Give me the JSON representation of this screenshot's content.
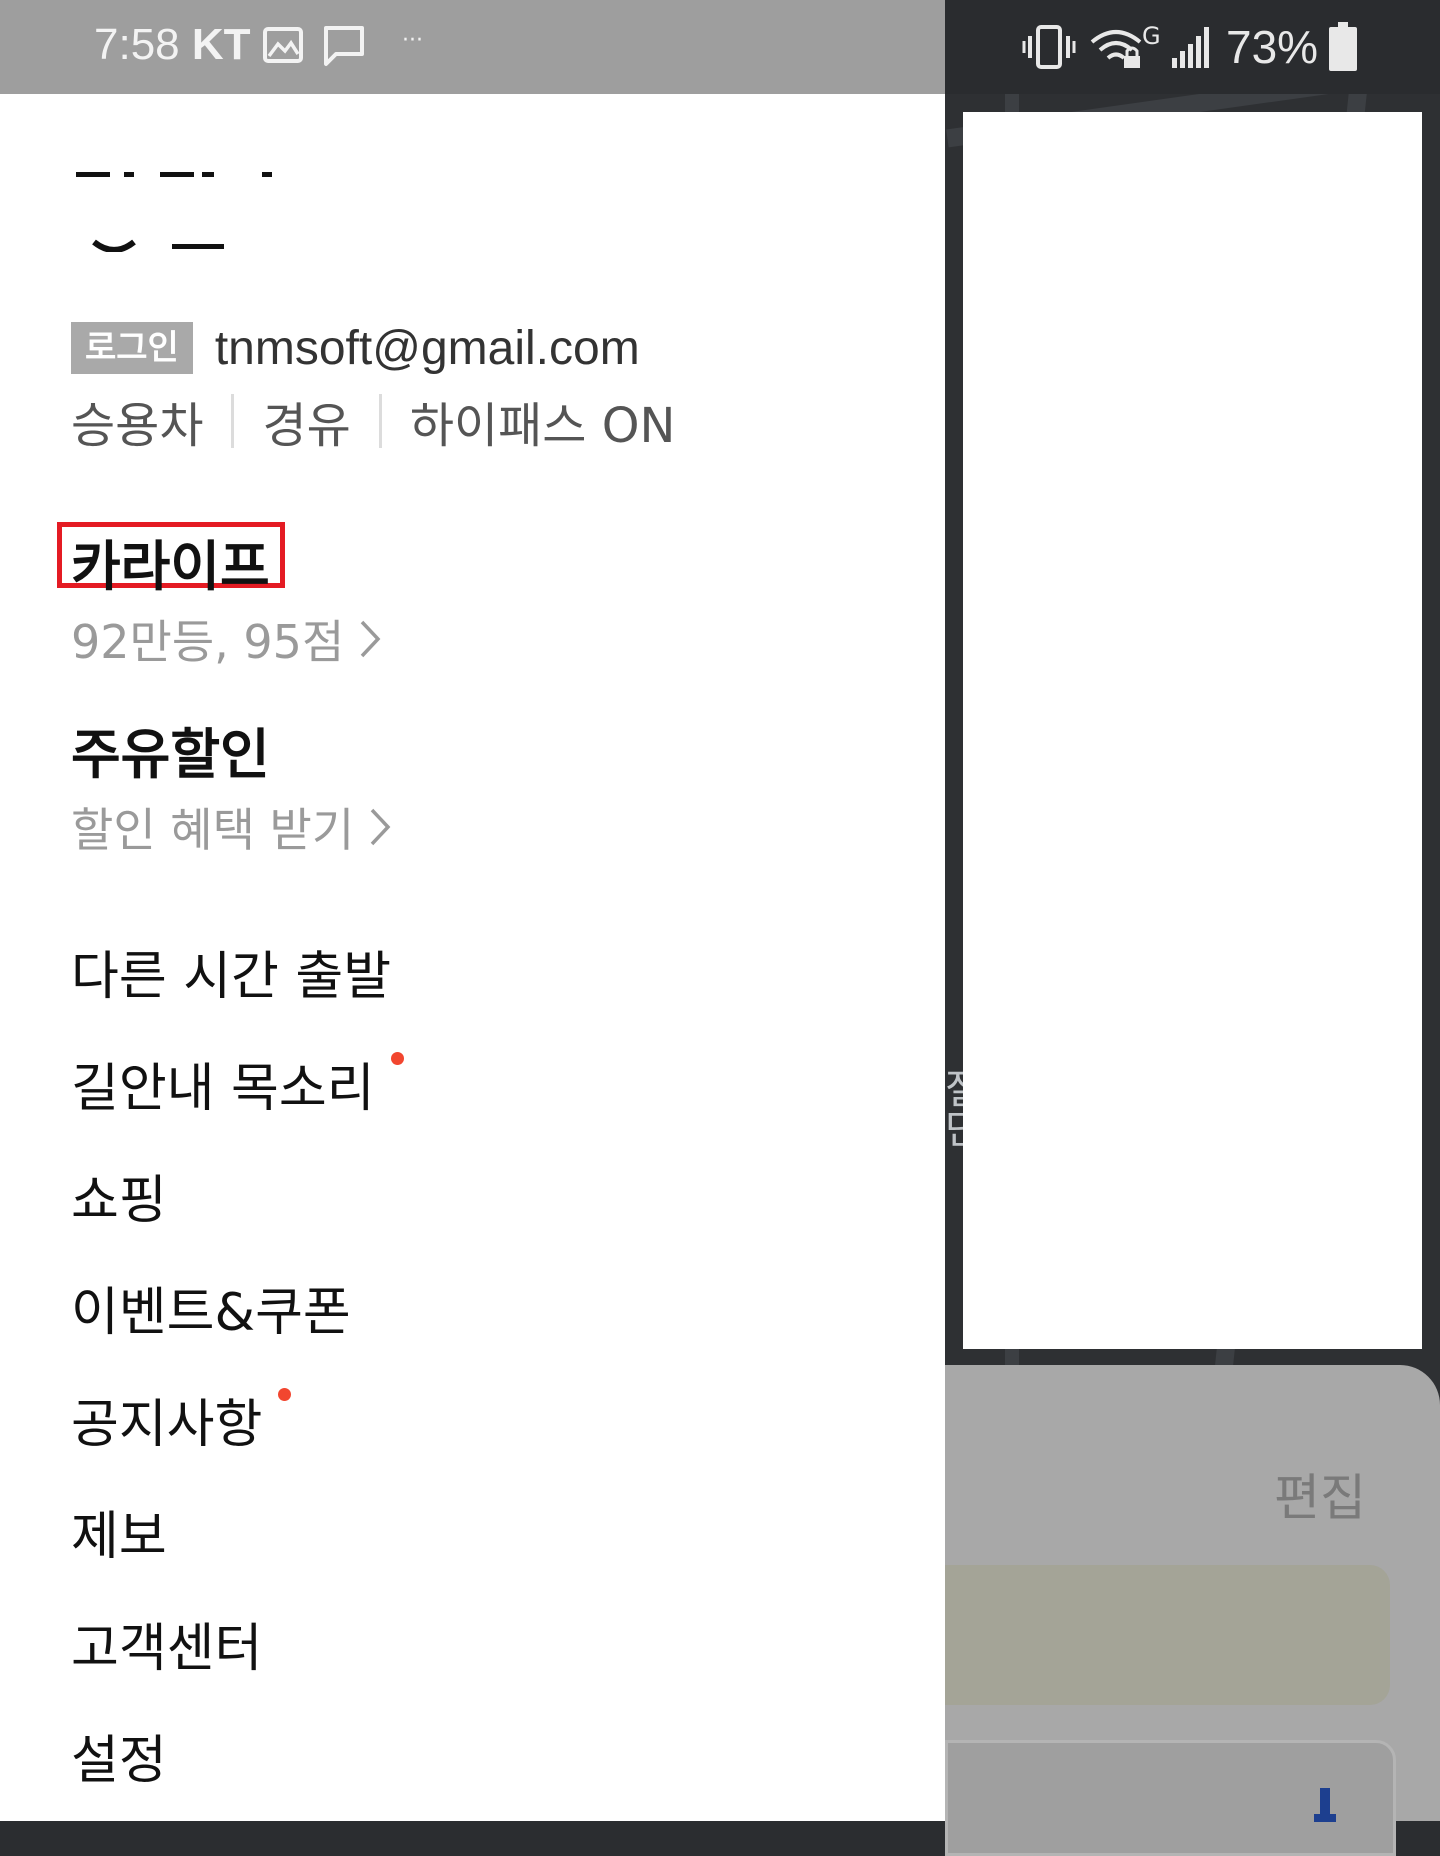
{
  "status_bar": {
    "time": "7:58",
    "carrier": "KT",
    "icons": [
      "image-icon",
      "message-icon",
      "more-dots-icon",
      "vibrate-icon",
      "wifi-icon",
      "signal-icon",
      "battery-icon"
    ],
    "more": "···",
    "network_type": "G",
    "battery": "73%"
  },
  "drawer": {
    "login_badge": "로그인",
    "email": "tnmsoft@gmail.com",
    "vehicle": [
      "승용차",
      "경유",
      "하이패스 ON"
    ],
    "sections": [
      {
        "title": "카라이프",
        "subtitle": "92만등, 95점"
      },
      {
        "title": "주유할인",
        "subtitle": "할인 혜택 받기"
      }
    ],
    "menu": [
      {
        "label": "다른 시간 출발",
        "dot": false
      },
      {
        "label": "길안내 목소리",
        "dot": true
      },
      {
        "label": "쇼핑",
        "dot": false
      },
      {
        "label": "이벤트&쿠폰",
        "dot": false
      },
      {
        "label": "공지사항",
        "dot": true
      },
      {
        "label": "제보",
        "dot": false
      },
      {
        "label": "고객센터",
        "dot": false
      },
      {
        "label": "설정",
        "dot": false
      }
    ]
  },
  "background": {
    "edit_label": "편집",
    "map_label": "절단"
  },
  "colors": {
    "highlight": "#e41b23",
    "notification_dot": "#f2462f",
    "status_bar": "#9e9e9e"
  }
}
